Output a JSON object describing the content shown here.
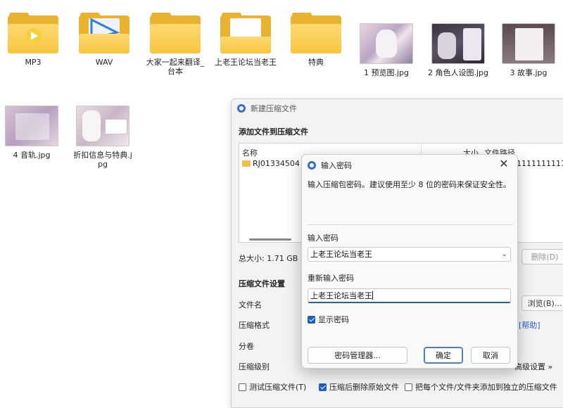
{
  "desktop": {
    "items": [
      {
        "label": "MP3",
        "kind": "folder-music"
      },
      {
        "label": "WAV",
        "kind": "folder-media"
      },
      {
        "label": "大家一起来翻译_台本",
        "kind": "folder"
      },
      {
        "label": "上老王论坛当老王",
        "kind": "folder-doc"
      },
      {
        "label": "特典",
        "kind": "folder"
      },
      {
        "label": "1 预览图.jpg",
        "kind": "image"
      },
      {
        "label": "2 角色人设图.jpg",
        "kind": "image"
      },
      {
        "label": "3 故事.jpg",
        "kind": "image"
      },
      {
        "label": "4 音轨.jpg",
        "kind": "image"
      },
      {
        "label": "折扣信息与特典.jpg",
        "kind": "image"
      }
    ]
  },
  "archive_dialog": {
    "title": "新建压缩文件",
    "add_section": "添加文件到压缩文件",
    "columns": {
      "name": "名称",
      "size": "大小",
      "path": "文件路径"
    },
    "row": {
      "name": "RJ01334504",
      "path": "1111111111"
    },
    "total_size": "总大小: 1.71 GB",
    "delete_button": "删除(D)",
    "settings_section": "压缩文件设置",
    "fields": {
      "filename": "文件名",
      "format": "压缩格式",
      "split": "分卷",
      "level": "压缩级别"
    },
    "browse_button": "浏览(B)...",
    "help_link": "[帮助]",
    "advanced_button": "高级设置 »",
    "options": [
      {
        "label": "测试压缩文件(T)",
        "checked": false
      },
      {
        "label": "压缩后删除原始文件",
        "checked": true
      },
      {
        "label": "把每个文件/文件夹添加到独立的压缩文件",
        "checked": false
      }
    ]
  },
  "password_dialog": {
    "title": "输入密码",
    "close_glyph": "✕",
    "description": "输入压缩包密码。建议使用至少 8 位的密码来保证安全性。",
    "password_label": "输入密码",
    "password_value": "上老王论坛当老王",
    "confirm_label": "重新输入密码",
    "confirm_value": "上老王论坛当老王",
    "show_password_label": "显示密码",
    "show_password_checked": true,
    "manager_button": "密码管理器...",
    "ok_button": "确定",
    "cancel_button": "取消"
  },
  "colors": {
    "accent": "#1f5fbf",
    "folder": "#f7c540"
  }
}
